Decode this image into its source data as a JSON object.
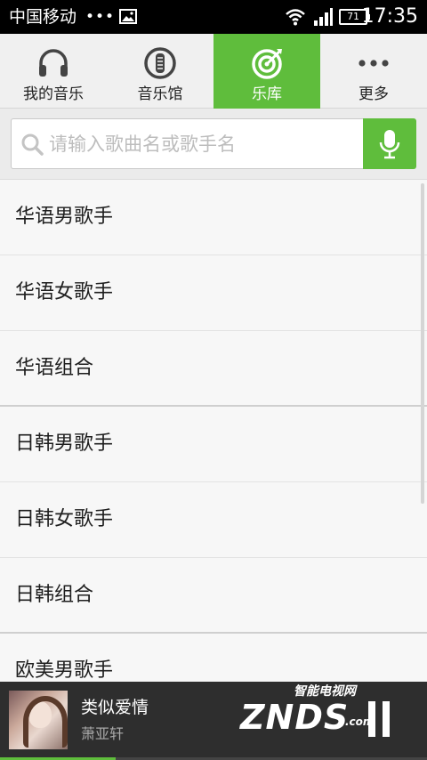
{
  "status_bar": {
    "carrier": "中国移动",
    "dots": "•••",
    "battery_level": "71",
    "time": "17:35"
  },
  "tabs": [
    {
      "label": "我的音乐",
      "icon": "headphones-icon",
      "active": false
    },
    {
      "label": "音乐馆",
      "icon": "music-hall-icon",
      "active": false
    },
    {
      "label": "乐库",
      "icon": "target-icon",
      "active": true
    },
    {
      "label": "更多",
      "icon": "more-dots-icon",
      "active": false
    }
  ],
  "search": {
    "placeholder": "请输入歌曲名或歌手名",
    "value": ""
  },
  "list": {
    "items": [
      "华语男歌手",
      "华语女歌手",
      "华语组合",
      "日韩男歌手",
      "日韩女歌手",
      "日韩组合",
      "欧美男歌手"
    ]
  },
  "player": {
    "title": "类似爱情",
    "artist": "萧亚轩",
    "progress": 0.27
  },
  "watermark": {
    "top": "智能电视网",
    "main": "ZNDS",
    "suffix": ".com"
  },
  "colors": {
    "accent": "#5fbd3c",
    "status_bar": "#000000",
    "player_bg": "#2e2e2e"
  }
}
